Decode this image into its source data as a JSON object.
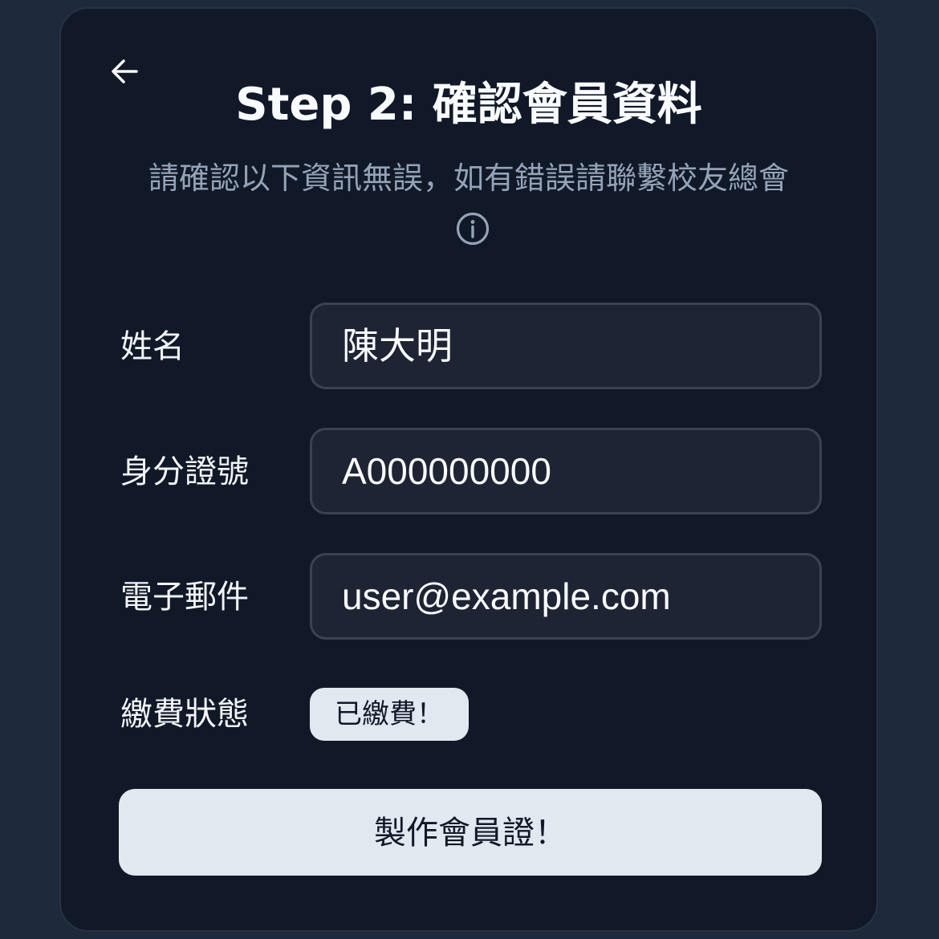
{
  "header": {
    "back_icon": "arrow-left-icon",
    "title": "Step 2: 確認會員資料",
    "subtitle": "請確認以下資訊無誤，如有錯誤請聯繫校友總會",
    "info_icon": "info-circle-icon"
  },
  "form": {
    "name_label": "姓名",
    "name_value": "陳大明",
    "id_label": "身分證號",
    "id_value": "A000000000",
    "email_label": "電子郵件",
    "email_value": "user@example.com",
    "payment_label": "繳費狀態",
    "payment_status": "已繳費！"
  },
  "actions": {
    "submit_label": "製作會員證！"
  },
  "colors": {
    "background": "#1e293b",
    "card": "#111827",
    "input_bg": "#1e2433",
    "input_border": "#3a4254",
    "accent_light": "#e2e8f0",
    "subtitle": "#94a3b8"
  }
}
